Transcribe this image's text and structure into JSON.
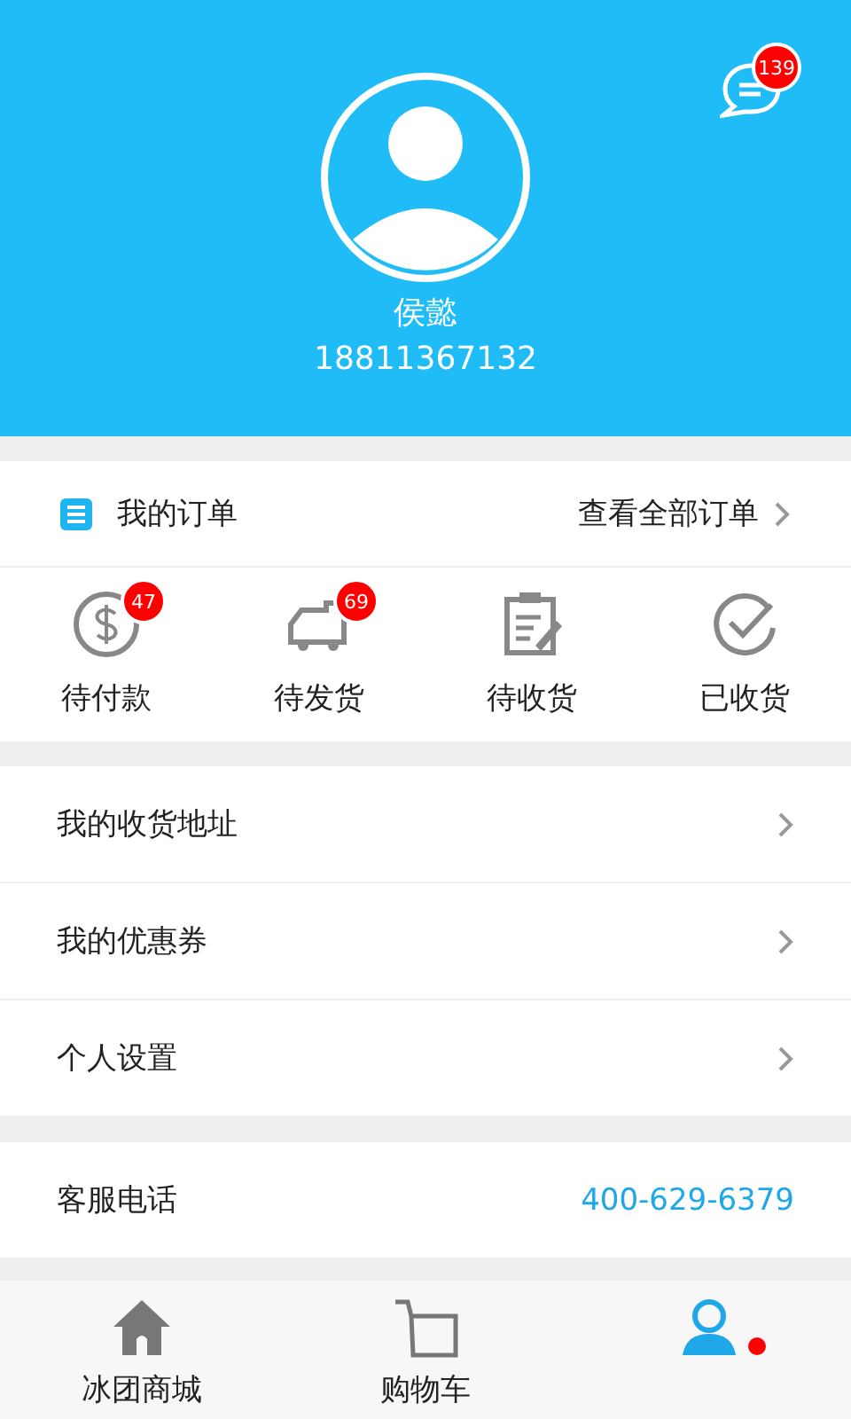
{
  "profile": {
    "name": "侯懿",
    "phone": "18811367132",
    "messages_badge": "139"
  },
  "orders": {
    "title": "我的订单",
    "view_all": "查看全部订单",
    "statuses": [
      {
        "kind": "payment",
        "label": "待付款",
        "badge": "47"
      },
      {
        "kind": "shipping",
        "label": "待发货",
        "badge": "69"
      },
      {
        "kind": "receiving",
        "label": "待收货"
      },
      {
        "kind": "received",
        "label": "已收货"
      }
    ]
  },
  "menu": [
    "我的收货地址",
    "我的优惠券",
    "个人设置"
  ],
  "service": {
    "label": "客服电话",
    "phone": "400-629-6379"
  },
  "tab_bar": [
    {
      "kind": "home",
      "label": "冰团商城",
      "selected": false,
      "dot": false
    },
    {
      "kind": "cart",
      "label": "购物车",
      "selected": false,
      "dot": false
    },
    {
      "kind": "user",
      "selected": true,
      "dot": true
    }
  ]
}
